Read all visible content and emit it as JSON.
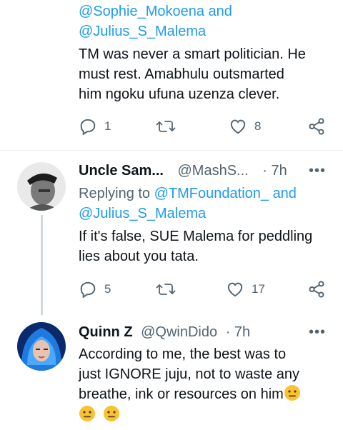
{
  "tweets": [
    {
      "reply_handles_top": "@Sophie_Mokoena and",
      "reply_handles_bottom": "@Julius_S_Malema",
      "body_lines": [
        "TM was never a smart politician. He",
        "must rest. Amabhulu outsmarted",
        "him ngoku ufuna uzenza clever."
      ],
      "reply_count": "1",
      "retweet_count": "",
      "like_count": "8"
    },
    {
      "name": "Uncle Sam...",
      "handle": "@MashS...",
      "time": "· 7h",
      "replying_to_label": "Replying to",
      "replying_to_handle": "@TMFoundation_ and",
      "replying_to_handle_2": "@Julius_S_Malema",
      "body_lines": [
        "If it's false, SUE Malema for peddling",
        "lies about you tata."
      ],
      "reply_count": "5",
      "retweet_count": "",
      "like_count": "17"
    },
    {
      "name": "Quinn Z",
      "handle": "@QwinDido",
      "time": "· 7h",
      "body_lines": [
        "According to me, the best was to",
        "just IGNORE juju, not to waste any",
        "breathe, ink or resources on him"
      ]
    }
  ],
  "more_label": "•••",
  "icons": {
    "reply": "reply-icon",
    "retweet": "retweet-icon",
    "like": "heart-icon",
    "share": "share-icon",
    "emoji": "neutral-face-emoji"
  },
  "colors": {
    "link": "#1d9bf0",
    "muted": "#536471",
    "text": "#0f1419",
    "emoji_yellow": "#f7c234"
  }
}
